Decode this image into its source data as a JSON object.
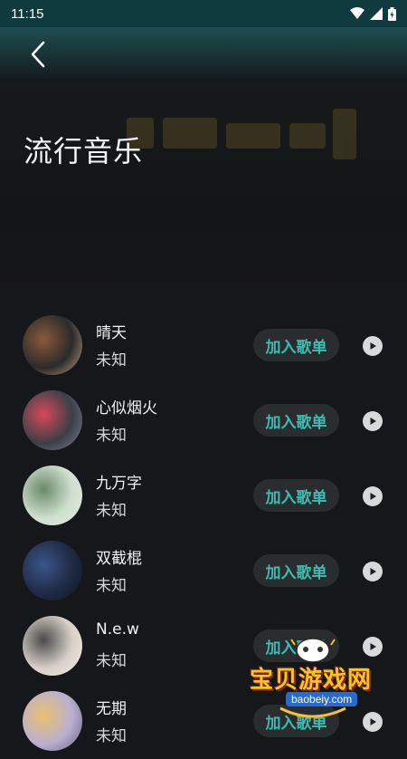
{
  "status_bar": {
    "time": "11:15"
  },
  "header": {
    "back_icon": "chevron-left-icon"
  },
  "page": {
    "title": "流行音乐"
  },
  "songs": [
    {
      "title": "晴天",
      "artist": "未知",
      "add_label": "加入歌单",
      "colors": [
        "#2b2b2b",
        "#8a5a3a",
        "#c9a080"
      ]
    },
    {
      "title": "心似烟火",
      "artist": "未知",
      "add_label": "加入歌单",
      "colors": [
        "#3b3f48",
        "#d64a5a",
        "#7a8090"
      ]
    },
    {
      "title": "九万字",
      "artist": "未知",
      "add_label": "加入歌单",
      "colors": [
        "#cfe0cf",
        "#6a8a6a",
        "#e8e8e0"
      ]
    },
    {
      "title": "双截棍",
      "artist": "未知",
      "add_label": "加入歌单",
      "colors": [
        "#1f2a44",
        "#3a5688",
        "#101520"
      ]
    },
    {
      "title": "N.e.w",
      "artist": "未知",
      "add_label": "加入歌单",
      "colors": [
        "#d8d0c8",
        "#4a4a4a",
        "#f2eee8"
      ]
    },
    {
      "title": "无期",
      "artist": "未知",
      "add_label": "加入歌单",
      "colors": [
        "#b8b0d0",
        "#e8c070",
        "#6a6080"
      ]
    }
  ],
  "watermark": {
    "text": "宝贝游戏网",
    "url": "baobeiy.com"
  },
  "colors": {
    "accent": "#3fbcb0",
    "header": "#1e4e52",
    "background": "#16171a"
  }
}
